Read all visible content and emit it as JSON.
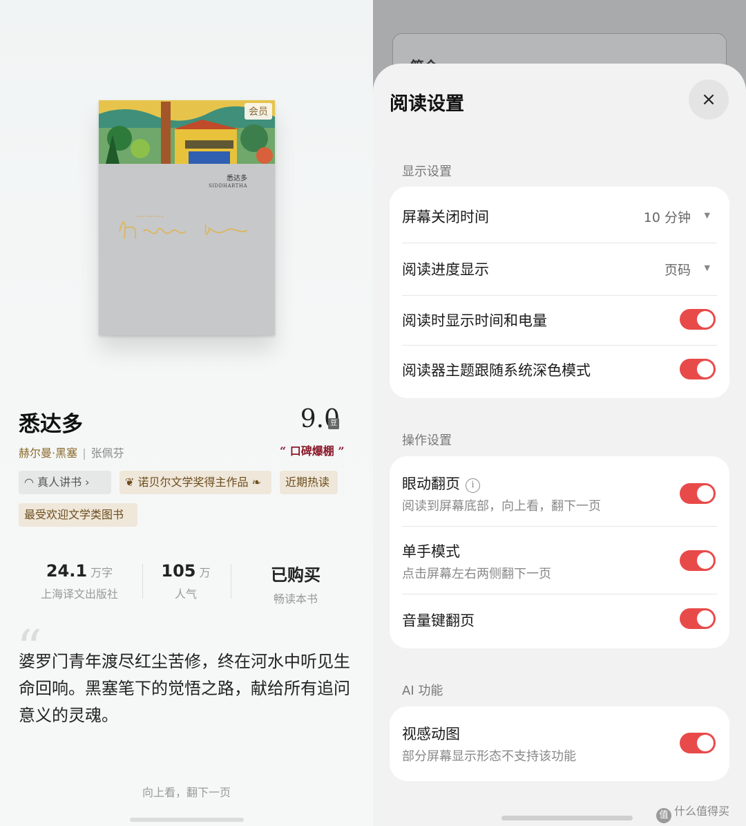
{
  "book": {
    "cover_badge": "会员",
    "cover_title": "悉达多",
    "cover_subtitle": "SIDDHARTHA",
    "title": "悉达多",
    "author": "赫尔曼·黑塞",
    "author_sep": "|",
    "translator": "张佩芬",
    "score": "9.0",
    "score_icon": "豆",
    "rating_tag": "“ 口碑爆棚 ”",
    "tags": {
      "audio": "真人讲书 ›",
      "nobel": "诺贝尔文学奖得主作品",
      "hot": "近期热读",
      "popular": "最受欢迎文学类图书"
    },
    "stats": {
      "words_value": "24.1",
      "words_unit": "万字",
      "publisher": "上海译文出版社",
      "popularity_value": "105",
      "popularity_unit": "万",
      "popularity_label": "人气",
      "purchase_status": "已购买",
      "purchase_label": "畅读本书"
    },
    "quote": "婆罗门青年渡尽红尘苦修，终在河水中听见生命回响。黑塞笔下的觉悟之路，献给所有追问意义的灵魂。",
    "page_hint": "向上看，翻下一页"
  },
  "background": {
    "card_title": "简介"
  },
  "settings": {
    "title": "阅读设置",
    "close_icon": "×",
    "display": {
      "label": "显示设置",
      "screen_off_label": "屏幕关闭时间",
      "screen_off_value": "10 分钟",
      "progress_label": "阅读进度显示",
      "progress_value": "页码",
      "show_time_battery_label": "阅读时显示时间和电量",
      "show_time_battery_on": true,
      "dark_mode_follow_label": "阅读器主题跟随系统深色模式",
      "dark_mode_follow_on": true
    },
    "operation": {
      "label": "操作设置",
      "eye_turn_label": "眼动翻页",
      "eye_turn_desc": "阅读到屏幕底部，向上看，翻下一页",
      "eye_turn_on": true,
      "one_hand_label": "单手模式",
      "one_hand_desc": "点击屏幕左右两侧翻下一页",
      "one_hand_on": true,
      "volume_key_label": "音量键翻页",
      "volume_key_on": true
    },
    "ai": {
      "label": "AI 功能",
      "visual_motion_label": "视感动图",
      "visual_motion_desc": "部分屏幕显示形态不支持该功能",
      "visual_motion_on": true
    }
  },
  "watermark": {
    "logo": "值",
    "text": "什么值得买"
  },
  "colors": {
    "toggle_on": "#e84a4a",
    "author_gold": "#8a6a2a",
    "rating_red": "#8b1a2a"
  }
}
